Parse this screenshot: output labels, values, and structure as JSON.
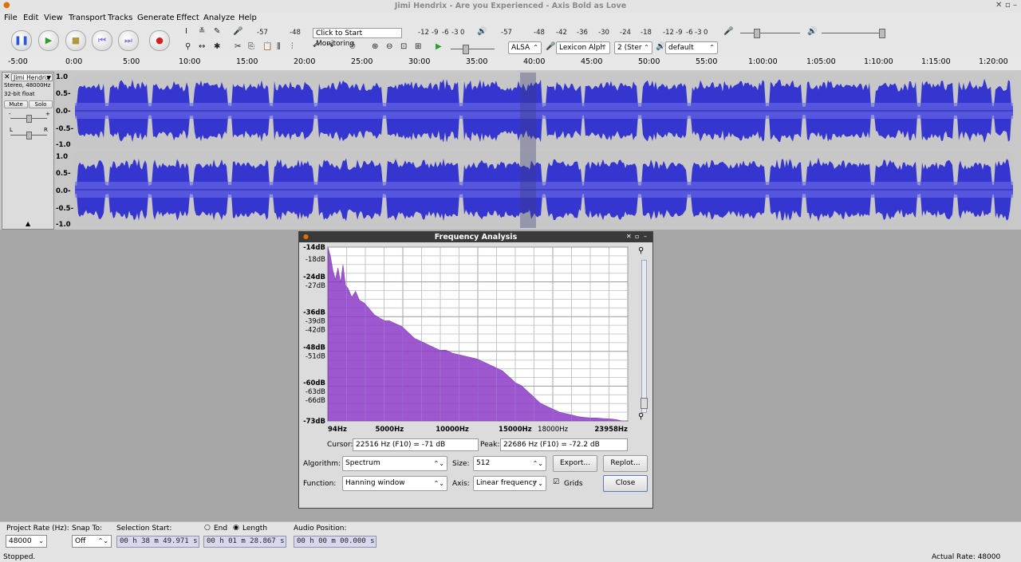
{
  "window": {
    "title": "Jimi Hendrix - Are you Experienced - Axis Bold as Love"
  },
  "menu": [
    "File",
    "Edit",
    "View",
    "Transport",
    "Tracks",
    "Generate",
    "Effect",
    "Analyze",
    "Help"
  ],
  "transport": {
    "pause": "Pause",
    "play": "Play",
    "stop": "Stop",
    "skip_start": "Skip to Start",
    "skip_end": "Skip to End",
    "record": "Record"
  },
  "meters": {
    "record_scale": [
      "-57",
      "-48",
      "-12",
      "-9",
      "-6",
      "-3",
      "0"
    ],
    "monitor_label": "Click to Start Monitoring",
    "play_scale": [
      "-57",
      "-48",
      "-42",
      "-36",
      "-30",
      "-24",
      "-18",
      "-12",
      "-9",
      "-6",
      "-3",
      "0"
    ]
  },
  "devices": {
    "host": "ALSA",
    "input": "Lexicon Alph",
    "channels": "2 (Ster",
    "output": "default"
  },
  "ruler": [
    "-5:00",
    "0:00",
    "5:00",
    "10:00",
    "15:00",
    "20:00",
    "25:00",
    "30:00",
    "35:00",
    "40:00",
    "45:00",
    "50:00",
    "55:00",
    "1:00:00",
    "1:05:00",
    "1:10:00",
    "1:15:00",
    "1:20:00"
  ],
  "track": {
    "name": "Jimi Hendrix",
    "info1": "Stereo, 48000Hz",
    "info2": "32-bit float",
    "mute": "Mute",
    "solo": "Solo",
    "gain_minus": "-",
    "gain_plus": "+",
    "pan_left": "L",
    "pan_right": "R",
    "scale": [
      "1.0",
      "0.5-",
      "0.0-",
      "-0.5-",
      "-1.0"
    ],
    "wave_color": "#3535d0"
  },
  "freq": {
    "title": "Frequency Analysis",
    "db_labels": [
      "-14dB",
      "-18dB",
      "-24dB",
      "-27dB",
      "-36dB",
      "-39dB",
      "-42dB",
      "-48dB",
      "-51dB",
      "-60dB",
      "-63dB",
      "-66dB",
      "-73dB"
    ],
    "hz_labels": [
      "94Hz",
      "5000Hz",
      "10000Hz",
      "15000Hz",
      "18000Hz",
      "23958Hz"
    ],
    "cursor_label": "Cursor:",
    "cursor_value": "22516 Hz (F10) = -71 dB",
    "peak_label": "Peak:",
    "peak_value": "22686 Hz (F10) = -72.2 dB",
    "algorithm_label": "Algorithm:",
    "algorithm": "Spectrum",
    "size_label": "Size:",
    "size": "512",
    "export": "Export...",
    "replot": "Replot...",
    "function_label": "Function:",
    "function": "Hanning window",
    "axis_label": "Axis:",
    "axis": "Linear frequency",
    "grids": "Grids",
    "close": "Close",
    "spectrum_color": "#8c3cc8"
  },
  "chart_data": {
    "type": "area",
    "xlabel": "",
    "ylabel": "",
    "xlim": [
      94,
      23958
    ],
    "ylim": [
      -73,
      -14
    ],
    "grid": true,
    "x": [
      94,
      300,
      500,
      700,
      900,
      1100,
      1300,
      1500,
      1700,
      2000,
      2300,
      2600,
      3000,
      3400,
      3800,
      4200,
      4600,
      5000,
      5500,
      6000,
      6500,
      7000,
      7500,
      8000,
      8500,
      9000,
      9500,
      10000,
      10500,
      11000,
      11500,
      12000,
      12500,
      13000,
      13500,
      14000,
      14500,
      15000,
      15500,
      16000,
      16500,
      17000,
      17500,
      18000,
      18500,
      19000,
      19500,
      20000,
      20500,
      21000,
      21500,
      22000,
      22500,
      23000,
      23500,
      23958
    ],
    "values": [
      -14,
      -17,
      -22,
      -25,
      -21,
      -26,
      -20,
      -27,
      -28,
      -31,
      -29,
      -32,
      -33,
      -35,
      -37,
      -38,
      -39,
      -39,
      -40,
      -41,
      -43,
      -45,
      -46,
      -47,
      -48,
      -49,
      -49,
      -50,
      -50.5,
      -51,
      -51.5,
      -52,
      -53,
      -54,
      -55,
      -56,
      -58,
      -60,
      -61,
      -63,
      -65,
      -67,
      -68,
      -69,
      -70,
      -70.5,
      -71,
      -71.5,
      -71.8,
      -72,
      -72,
      -72.2,
      -72.3,
      -72.5,
      -73,
      -73
    ]
  },
  "status": {
    "project_rate_label": "Project Rate (Hz):",
    "project_rate": "48000",
    "snap_label": "Snap To:",
    "snap": "Off",
    "selection_start_label": "Selection Start:",
    "end_label": "End",
    "length_label": "Length",
    "selection_start": "00 h 38 m 49.971 s",
    "length": "00 h 01 m 28.867 s",
    "audio_position_label": "Audio Position:",
    "audio_position": "00 h 00 m 00.000 s",
    "state": "Stopped.",
    "actual_rate": "Actual Rate: 48000"
  }
}
